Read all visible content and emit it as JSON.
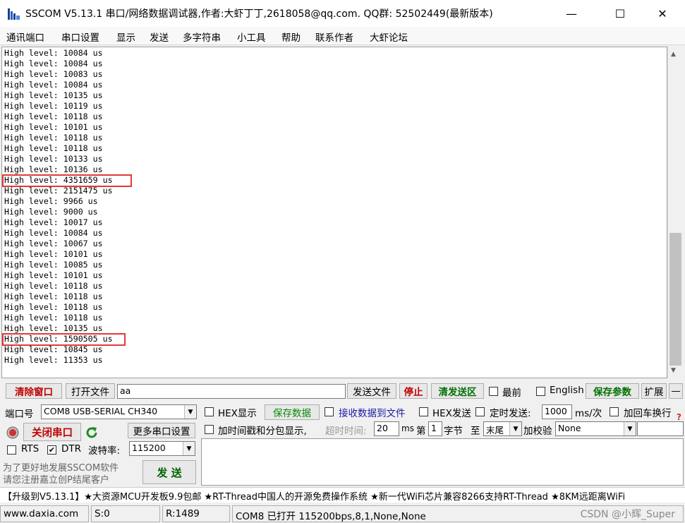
{
  "window": {
    "title": "SSCOM V5.13.1 串口/网络数据调试器,作者:大虾丁丁,2618058@qq.com. QQ群: 52502449(最新版本)",
    "minimize": "—",
    "maximize": "☐",
    "close": "✕"
  },
  "menu": [
    "通讯端口",
    "串口设置",
    "显示",
    "发送",
    "多字符串",
    "小工具",
    "帮助",
    "联系作者",
    "大虾论坛"
  ],
  "log": {
    "lines": [
      "High level: 10084 us",
      "High level: 10084 us",
      "High level: 10083 us",
      "High level: 10084 us",
      "High level: 10135 us",
      "High level: 10119 us",
      "High level: 10118 us",
      "High level: 10101 us",
      "High level: 10118 us",
      "High level: 10118 us",
      "High level: 10133 us",
      "High level: 10136 us",
      "High level: 4351659 us",
      "High level: 2151475 us",
      "High level: 9966 us",
      "High level: 9000 us",
      "High level: 10017 us",
      "High level: 10084 us",
      "High level: 10067 us",
      "High level: 10101 us",
      "High level: 10085 us",
      "High level: 10101 us",
      "High level: 10118 us",
      "High level: 10118 us",
      "High level: 10118 us",
      "High level: 10118 us",
      "High level: 10135 us",
      "High level: 1590505 us",
      "High level: 10845 us",
      "High level: 11353 us"
    ],
    "highlighted_lines": [
      12,
      27
    ]
  },
  "toolbar": {
    "clear_window": "清除窗口",
    "open_file": "打开文件",
    "file_path": "aa",
    "send_file": "发送文件",
    "stop": "停止",
    "clear_send_area": "清发送区",
    "topmost": "最前",
    "english": "English",
    "save_params": "保存参数",
    "expand": "扩展",
    "collapse": "—"
  },
  "port": {
    "port_label": "端口号",
    "port_value": "COM8 USB-SERIAL CH340",
    "close_port": "关闭串口",
    "more_settings": "更多串口设置",
    "rts": "RTS",
    "dtr": "DTR",
    "baud_label": "波特率:",
    "baud_value": "115200",
    "promo_line1": "为了更好地发展SSCOM软件",
    "promo_line2": "请您注册嘉立创P结尾客户",
    "send": "发  送"
  },
  "options": {
    "hex_display": "HEX显示",
    "save_data": "保存数据",
    "recv_to_file": "接收数据到文件",
    "hex_send": "HEX发送",
    "timed_send": "定时发送:",
    "interval": "1000",
    "interval_unit": "ms/次",
    "add_crlf": "加回车换行",
    "timestamp": "加时间戳和分包显示,",
    "timeout_label": "超时时间:",
    "timeout_value": "20",
    "timeout_unit": "ms",
    "nth": "第",
    "byte_index": "1",
    "byte_label": "字节",
    "to": "至",
    "end_value": "末尾",
    "checksum_label": "加校验",
    "checksum_value": "None"
  },
  "marquee": "【升级到V5.13.1】★大资源MCU开发板9.9包邮 ★RT-Thread中国人的开源免费操作系统 ★新一代WiFi芯片兼容8266支持RT-Thread ★8KM远距离WiFi",
  "status": {
    "website": "www.daxia.com",
    "sent": "S:0",
    "received": "R:1489",
    "port_status": "COM8 已打开  115200bps,8,1,None,None"
  },
  "watermark": "CSDN @小辉_Super",
  "colors": {
    "highlight_box": "#e53935",
    "red_text": "#c00000",
    "green_text": "#007000"
  }
}
